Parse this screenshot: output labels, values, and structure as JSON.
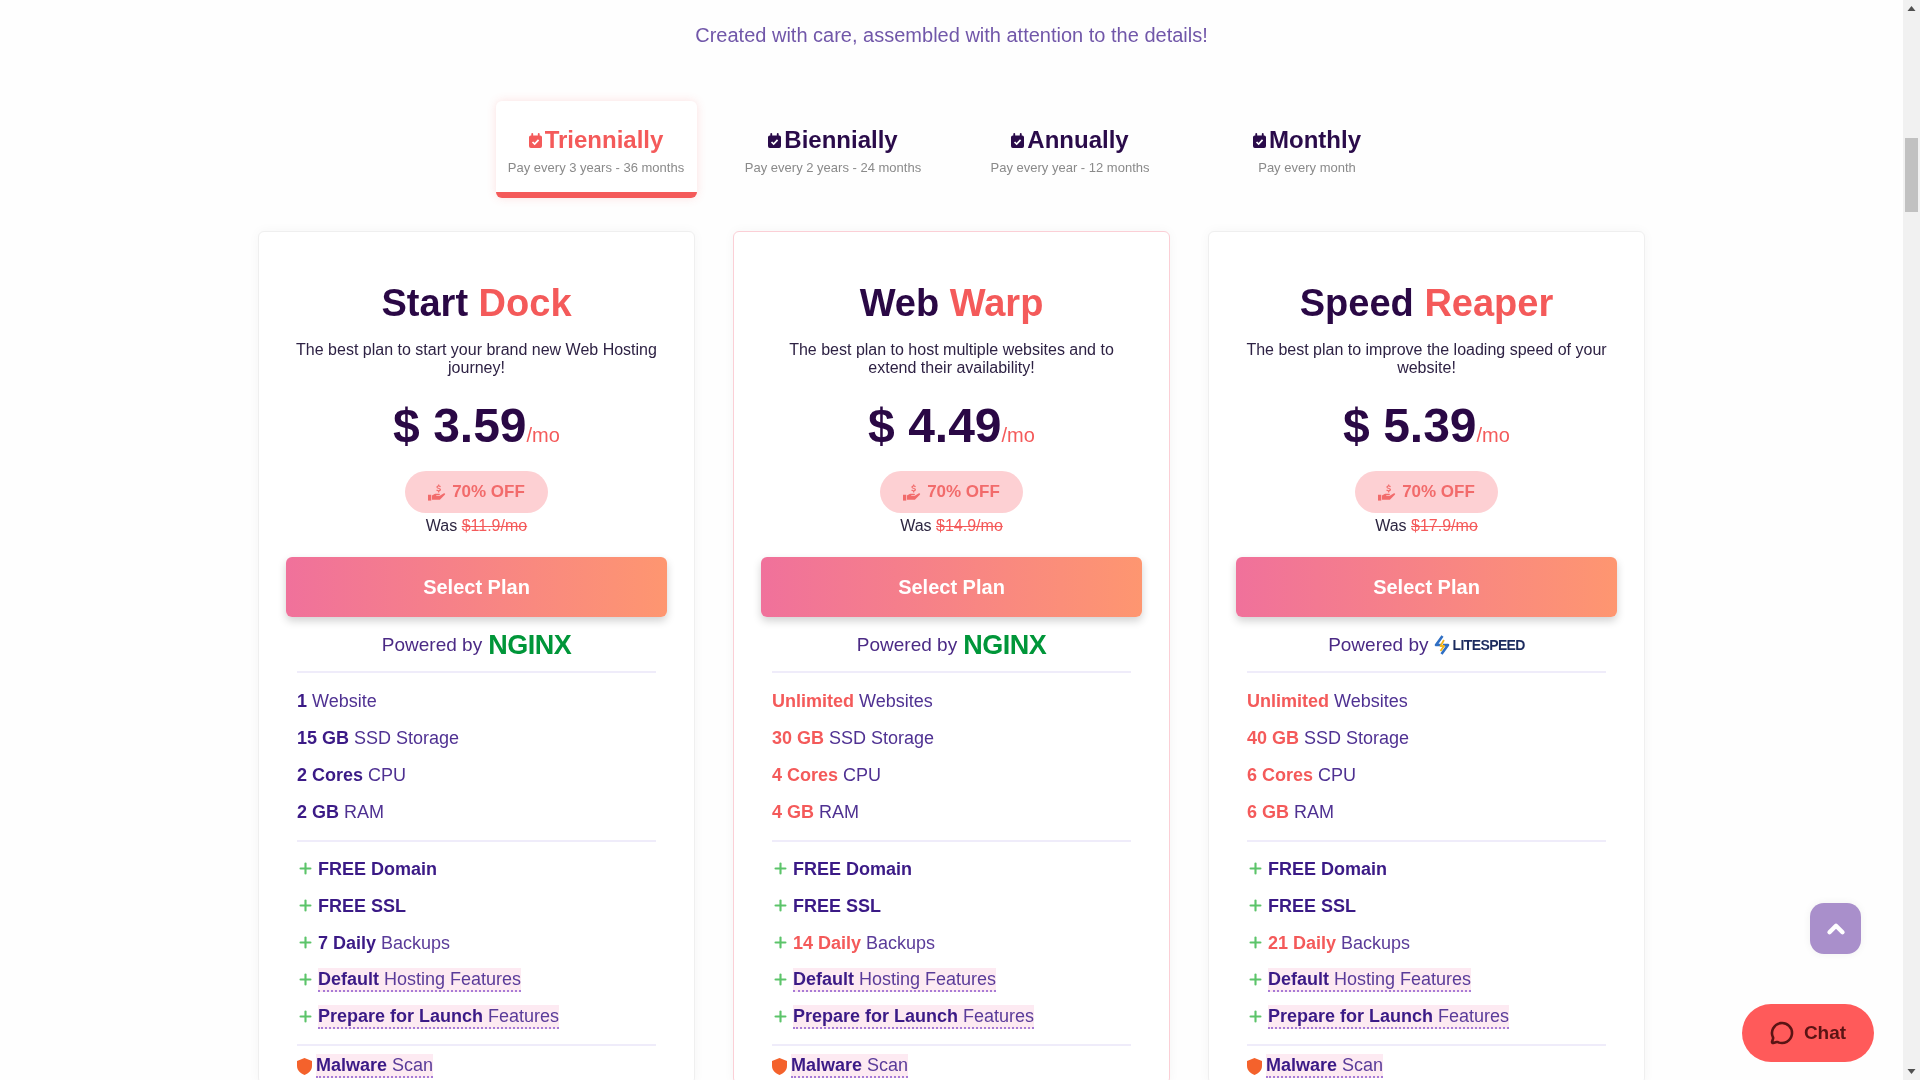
{
  "tagline": "Created with care, assembled with attention to the details!",
  "billing_tabs": [
    {
      "label": "Triennially",
      "note": "Pay every 3 years - 36 months",
      "selected": true
    },
    {
      "label": "Biennially",
      "note": "Pay every 2 years - 24 months",
      "selected": false
    },
    {
      "label": "Annually",
      "note": "Pay every year - 12 months",
      "selected": false
    },
    {
      "label": "Monthly",
      "note": "Pay every month",
      "selected": false
    }
  ],
  "plans": [
    {
      "name": "Start",
      "name_accent": "Dock",
      "highlighted": false,
      "description": "The best plan to start your brand new Web Hosting journey!",
      "price": "$ 3.59",
      "period": "/mo",
      "discount": "70% OFF",
      "was_label": "Was",
      "was_price": "$11.9/mo",
      "button": "Select Plan",
      "powered_by": {
        "label": "Powered by",
        "server": {
          "kind": "nginx",
          "name": "NGINX"
        }
      },
      "specs": [
        {
          "value": "1",
          "label": "Website",
          "accent": false
        },
        {
          "value": "15 GB",
          "label": "SSD Storage",
          "accent": false
        },
        {
          "value": "2 Cores",
          "label": "CPU",
          "accent": false
        },
        {
          "value": "2 GB",
          "label": "RAM",
          "accent": false
        }
      ],
      "features": [
        {
          "kind": "plain",
          "strong": "FREE Domain",
          "accent": false
        },
        {
          "kind": "plain",
          "strong": "FREE SSL",
          "accent": false
        },
        {
          "kind": "plain",
          "strong": "7 Daily",
          "text": "Backups",
          "accent": false
        },
        {
          "kind": "tooltip",
          "strong": "Default",
          "text": "Hosting Features",
          "accent": false
        },
        {
          "kind": "tooltip",
          "strong": "Prepare for Launch",
          "text": "Features",
          "accent": false
        }
      ],
      "security": [
        {
          "kind": "tooltip",
          "strong": "Malware",
          "text": "Scan"
        }
      ]
    },
    {
      "name": "Web",
      "name_accent": "Warp",
      "highlighted": true,
      "description": "The best plan to host multiple websites and to extend their availability!",
      "price": "$ 4.49",
      "period": "/mo",
      "discount": "70% OFF",
      "was_label": "Was",
      "was_price": "$14.9/mo",
      "button": "Select Plan",
      "powered_by": {
        "label": "Powered by",
        "server": {
          "kind": "nginx",
          "name": "NGINX"
        }
      },
      "specs": [
        {
          "value": "Unlimited",
          "label": "Websites",
          "accent": true
        },
        {
          "value": "30 GB",
          "label": "SSD Storage",
          "accent": true
        },
        {
          "value": "4 Cores",
          "label": "CPU",
          "accent": true
        },
        {
          "value": "4 GB",
          "label": "RAM",
          "accent": true
        }
      ],
      "features": [
        {
          "kind": "plain",
          "strong": "FREE Domain",
          "accent": false
        },
        {
          "kind": "plain",
          "strong": "FREE SSL",
          "accent": false
        },
        {
          "kind": "plain",
          "strong": "14 Daily",
          "text": "Backups",
          "accent": true
        },
        {
          "kind": "tooltip",
          "strong": "Default",
          "text": "Hosting Features",
          "accent": false
        },
        {
          "kind": "tooltip",
          "strong": "Prepare for Launch",
          "text": "Features",
          "accent": false
        }
      ],
      "security": [
        {
          "kind": "tooltip",
          "strong": "Malware",
          "text": "Scan"
        }
      ]
    },
    {
      "name": "Speed",
      "name_accent": "Reaper",
      "highlighted": false,
      "description": "The best plan to improve the loading speed of your website!",
      "price": "$ 5.39",
      "period": "/mo",
      "discount": "70% OFF",
      "was_label": "Was",
      "was_price": "$17.9/mo",
      "button": "Select Plan",
      "powered_by": {
        "label": "Powered by",
        "server": {
          "kind": "litespeed",
          "name": "LITESPEED"
        }
      },
      "specs": [
        {
          "value": "Unlimited",
          "label": "Websites",
          "accent": true
        },
        {
          "value": "40 GB",
          "label": "SSD Storage",
          "accent": true
        },
        {
          "value": "6 Cores",
          "label": "CPU",
          "accent": true
        },
        {
          "value": "6 GB",
          "label": "RAM",
          "accent": true
        }
      ],
      "features": [
        {
          "kind": "plain",
          "strong": "FREE Domain",
          "accent": false
        },
        {
          "kind": "plain",
          "strong": "FREE SSL",
          "accent": false
        },
        {
          "kind": "plain",
          "strong": "21 Daily",
          "text": "Backups",
          "accent": true
        },
        {
          "kind": "tooltip",
          "strong": "Default",
          "text": "Hosting Features",
          "accent": false
        },
        {
          "kind": "tooltip",
          "strong": "Prepare for Launch",
          "text": "Features",
          "accent": false
        }
      ],
      "security": [
        {
          "kind": "tooltip",
          "strong": "Malware",
          "text": "Scan"
        }
      ]
    }
  ],
  "chat_button": {
    "label": "Chat"
  }
}
